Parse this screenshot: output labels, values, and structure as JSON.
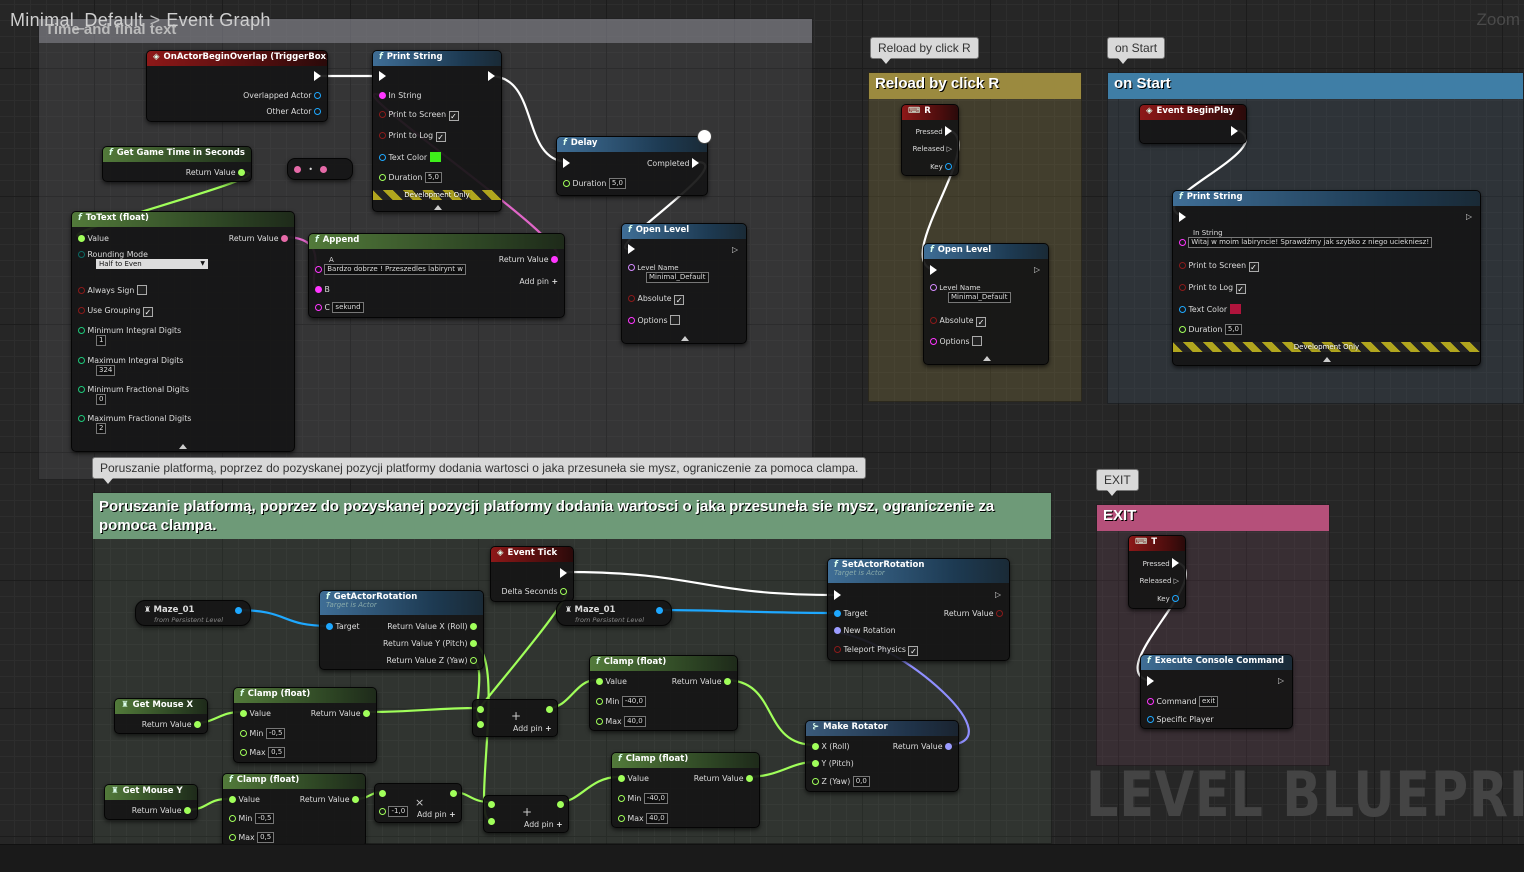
{
  "breadcrumb": {
    "level": "Minimal_Default",
    "separator": ">",
    "graph": "Event Graph"
  },
  "zoom": "Zoom",
  "watermark": "LEVEL BLUEPRINT",
  "comments": {
    "time_text": "Time and final text",
    "reload_tab": "Reload by click R",
    "reload_title": "Reload by click R",
    "start_tab": "on Start",
    "start_title": "on Start",
    "exit_tab": "EXIT",
    "exit_title": "EXIT",
    "platform_tab": "Poruszanie platformą, poprzez do pozyskanej pozycji platformy dodania wartosci o jaka przesuneła sie mysz, ograniczenie za pomoca clampa.",
    "platform_title": "Poruszanie platformą, poprzez do pozyskanej pozycji platformy dodania wartosci o jaka przesuneła sie mysz, ograniczenie za pomoca clampa."
  },
  "colors": {
    "exec": "#ffffff",
    "float": "#a0ff5a",
    "string": "#ff36ff",
    "object": "#1ea8ff",
    "bool": "#8b1a1a",
    "struct": "#7c8cff",
    "text": "#e66aa8",
    "link": "#d58bff"
  },
  "labels": {
    "on_actor_overlap": "OnActorBeginOverlap (TriggerBox)",
    "overlapped_actor": "Overlapped Actor",
    "other_actor": "Other Actor",
    "print_string": "Print String",
    "in_string": "In String",
    "print_to_screen": "Print to Screen",
    "print_to_log": "Print to Log",
    "text_color": "Text Color",
    "duration": "Duration",
    "duration_val": "5,0",
    "development_only": "Development Only",
    "delay": "Delay",
    "completed": "Completed",
    "open_level": "Open Level",
    "level_name": "Level Name",
    "level_name_val": "Minimal_Default",
    "absolute": "Absolute",
    "options": "Options",
    "get_game_time": "Get Game Time in Seconds",
    "return_value": "Return Value",
    "to_text": "ToText (float)",
    "value": "Value",
    "rounding_mode": "Rounding Mode",
    "rounding_val": "Half to Even",
    "always_sign": "Always Sign",
    "use_grouping": "Use Grouping",
    "min_integral": "Minimum Integral Digits",
    "min_integral_val": "1",
    "max_integral": "Maximum Integral Digits",
    "max_integral_val": "324",
    "min_fractional": "Minimum Fractional Digits",
    "min_fractional_val": "0",
    "max_fractional": "Maximum Fractional Digits",
    "max_fractional_val": "2",
    "append": "Append",
    "pin_a": "A",
    "pin_b": "B",
    "pin_c": "C",
    "append_a_val": "Bardzo dobrze ! Przeszedles labirynt w",
    "append_c_val": "sekund",
    "add_pin": "Add pin",
    "key_r": "R",
    "pressed": "Pressed",
    "released": "Released",
    "key": "Key",
    "event_begin_play": "Event BeginPlay",
    "start_string_val": "Witaj w moim labiryncie! Sprawdźmy jak szybko z niego uciekniesz!",
    "key_t": "T",
    "exec_console": "Execute Console Command",
    "command": "Command",
    "command_val": "exit",
    "specific_player": "Specific Player",
    "event_tick": "Event Tick",
    "delta_seconds": "Delta Seconds",
    "maze": "Maze_01",
    "from_persistent": "from Persistent Level",
    "get_actor_rotation": "GetActorRotation",
    "target_is_actor": "Target is Actor",
    "target": "Target",
    "rv_x": "Return Value X (Roll)",
    "rv_y": "Return Value Y (Pitch)",
    "rv_z": "Return Value Z (Yaw)",
    "set_actor_rotation": "SetActorRotation",
    "new_rotation": "New Rotation",
    "teleport_physics": "Teleport Physics",
    "get_mouse_x": "Get Mouse X",
    "get_mouse_y": "Get Mouse Y",
    "clamp": "Clamp (float)",
    "min": "Min",
    "max": "Max",
    "min_small": "-0,5",
    "max_small": "0,5",
    "min_big": "-40,0",
    "max_big": "40,0",
    "mult_val": "-1,0",
    "make_rotator": "Make Rotator",
    "x_roll": "X (Roll)",
    "y_pitch": "Y (Pitch)",
    "z_yaw": "Z (Yaw)",
    "zero": "0,0"
  }
}
